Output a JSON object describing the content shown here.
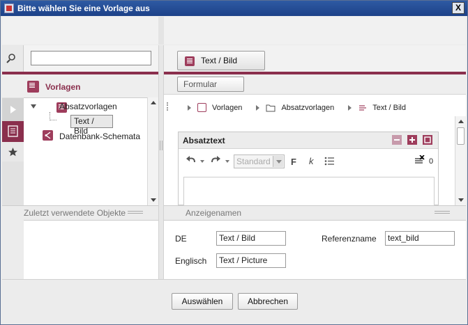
{
  "window": {
    "title": "Bitte wählen Sie eine Vorlage aus",
    "close_glyph": "X"
  },
  "search": {
    "icon": "search-icon",
    "value": ""
  },
  "left_nav": {
    "title": "Vorlagen"
  },
  "tree": {
    "root": "Absatzvorlagen",
    "child": "Text / Bild",
    "second": "Datenbank-Schemata"
  },
  "recent": {
    "title": "Zuletzt verwendete Objekte"
  },
  "preview": {
    "tab": "Text / Bild",
    "subtab": "Formular",
    "breadcrumb": [
      "Vorlagen",
      "Absatzvorlagen",
      "Text / Bild"
    ],
    "section_title": "Absatztext",
    "style_select": "Standard",
    "bold_glyph": "F",
    "italic_glyph": "k",
    "counter": "0"
  },
  "names": {
    "title": "Anzeigenamen",
    "de_label": "DE",
    "de_value": "Text / Bild",
    "en_label": "Englisch",
    "en_value": "Text / Picture",
    "ref_label": "Referenzname",
    "ref_value": "text_bild"
  },
  "buttons": {
    "select": "Auswählen",
    "cancel": "Abbrechen"
  },
  "colors": {
    "accent": "#8a2f4d",
    "titlebar": "#1d4188"
  }
}
